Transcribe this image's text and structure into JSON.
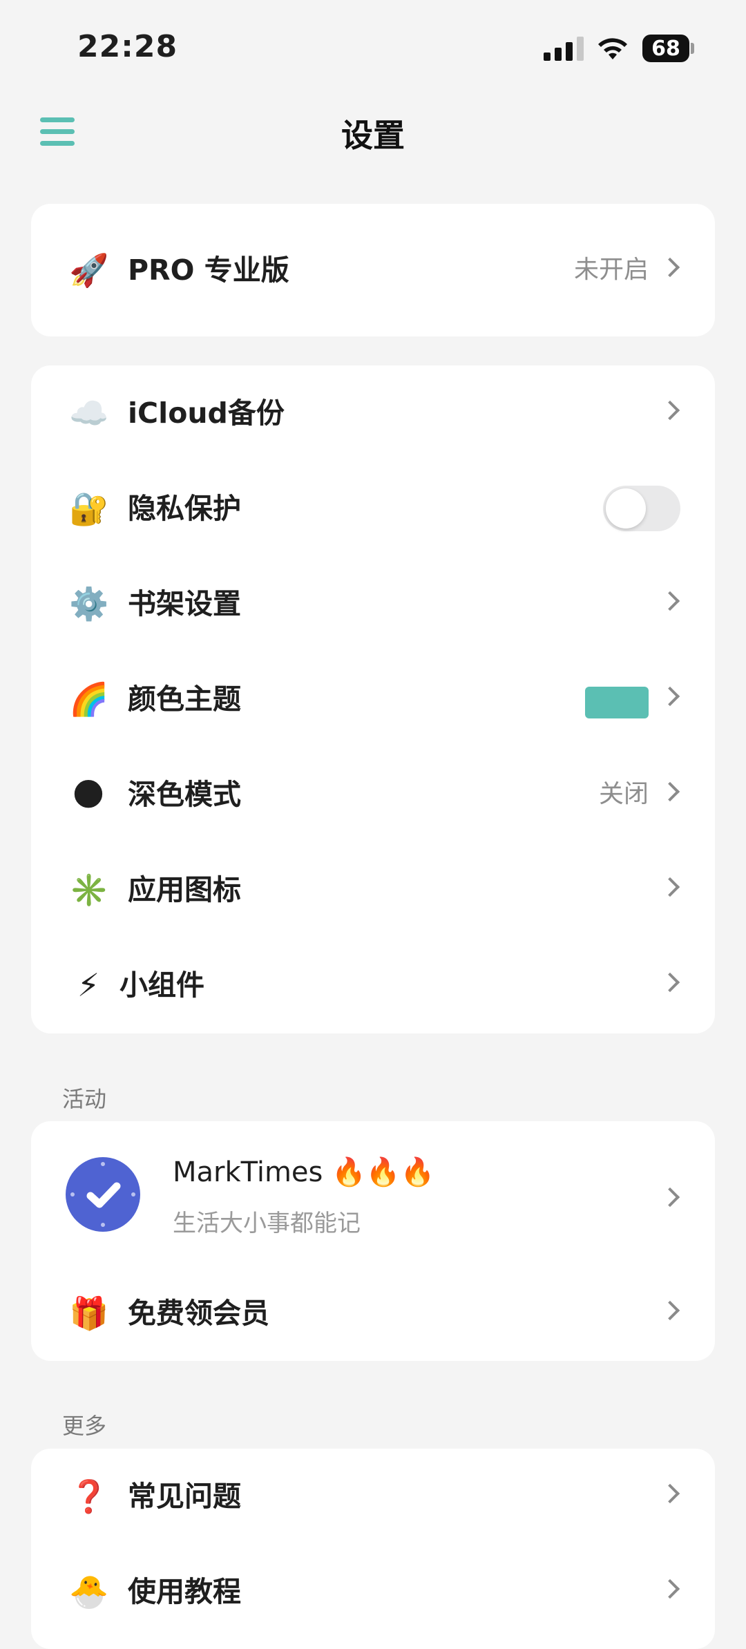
{
  "status_bar": {
    "time": "22:28",
    "battery": "68"
  },
  "header": {
    "title": "设置"
  },
  "pro_card": {
    "icon": "🚀",
    "label": "PRO 专业版",
    "value": "未开启"
  },
  "settings": {
    "items": [
      {
        "icon": "☁️",
        "label": "iCloud备份",
        "value": ""
      },
      {
        "icon": "🔐",
        "label": "隐私保护",
        "toggle_on": false
      },
      {
        "icon": "⚙️",
        "label": "书架设置",
        "value": ""
      },
      {
        "icon": "🌈",
        "label": "颜色主题",
        "swatch_color": "#5bbfb3"
      },
      {
        "icon": "🌑",
        "label": "深色模式",
        "value": "关闭"
      },
      {
        "icon": "✳️",
        "label": "应用图标",
        "value": ""
      },
      {
        "icon": "⚡",
        "label": "小组件",
        "value": ""
      }
    ]
  },
  "activity": {
    "header": "活动",
    "app": {
      "name": "MarkTimes 🔥🔥🔥",
      "subtitle": "生活大小事都能记",
      "icon_color": "#4f63d2"
    },
    "gift": {
      "icon": "🎁",
      "label": "免费领会员"
    }
  },
  "more": {
    "header": "更多",
    "items": [
      {
        "icon": "❓",
        "label": "常见问题"
      },
      {
        "icon": "🐣",
        "label": "使用教程"
      }
    ]
  },
  "colors": {
    "accent": "#5bbfb3",
    "background": "#f4f4f4",
    "card": "#ffffff"
  }
}
